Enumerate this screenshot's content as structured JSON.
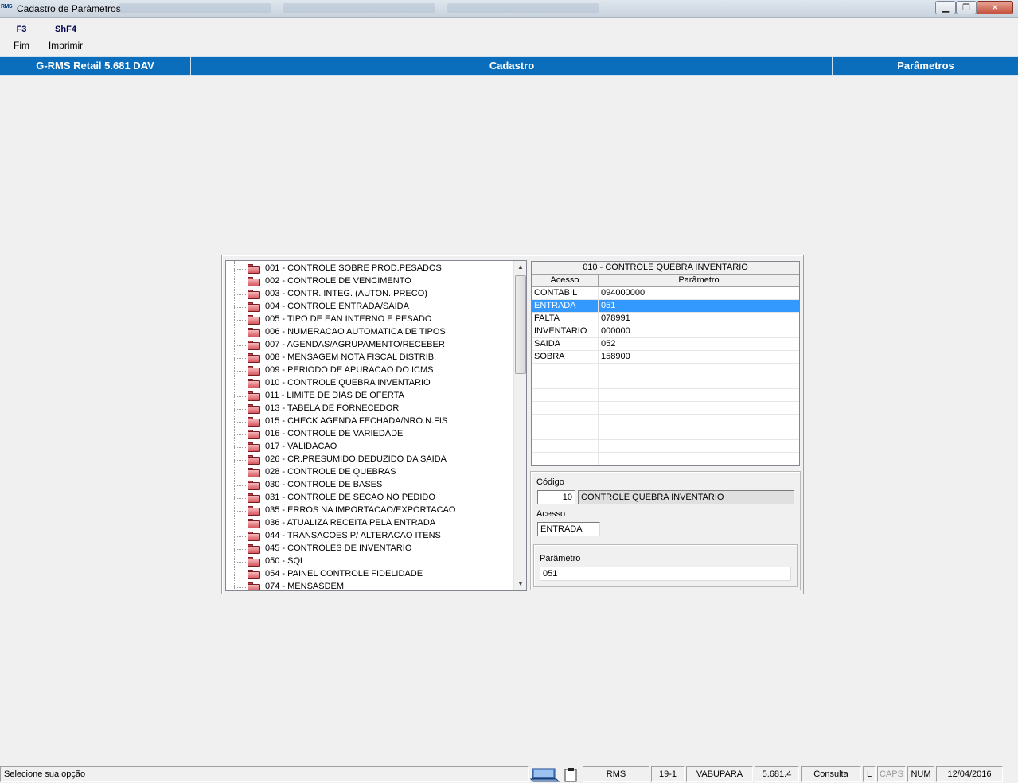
{
  "window": {
    "title": "Cadastro de Parâmetros",
    "app_badge": "RMS"
  },
  "toolbar": {
    "f3_key": "F3",
    "f3_label": "Fim",
    "shf4_key": "ShF4",
    "shf4_label": "Imprimir"
  },
  "header": {
    "product": "G-RMS Retail 5.681 DAV",
    "module": "Cadastro",
    "screen": "Parâmetros"
  },
  "tree": {
    "items": [
      "001 - CONTROLE SOBRE PROD.PESADOS",
      "002 - CONTROLE DE VENCIMENTO",
      "003 - CONTR. INTEG. (AUTON. PRECO)",
      "004 - CONTROLE ENTRADA/SAIDA",
      "005 - TIPO DE EAN INTERNO E PESADO",
      "006 - NUMERACAO AUTOMATICA DE TIPOS",
      "007 - AGENDAS/AGRUPAMENTO/RECEBER",
      "008 - MENSAGEM NOTA FISCAL DISTRIB.",
      "009 - PERIODO DE APURACAO DO ICMS",
      "010 - CONTROLE QUEBRA INVENTARIO",
      "011 - LIMITE DE DIAS DE OFERTA",
      "013 - TABELA DE FORNECEDOR",
      "015 - CHECK AGENDA FECHADA/NRO.N.FIS",
      "016 - CONTROLE DE VARIEDADE",
      "017 - VALIDACAO",
      "026 - CR.PRESUMIDO DEDUZIDO DA SAIDA",
      "028 - CONTROLE DE QUEBRAS",
      "030 - CONTROLE DE BASES",
      "031 - CONTROLE DE SECAO NO PEDIDO",
      "035 - ERROS NA IMPORTACAO/EXPORTACAO",
      "036 - ATUALIZA RECEITA PELA ENTRADA",
      "044 - TRANSACOES P/ ALTERACAO ITENS",
      "045 - CONTROLES DE INVENTARIO",
      "050 - SQL",
      "054 - PAINEL CONTROLE FIDELIDADE",
      "074 - MENSASDEM"
    ]
  },
  "grid": {
    "title": "010 - CONTROLE QUEBRA INVENTARIO",
    "col_acesso": "Acesso",
    "col_parametro": "Parâmetro",
    "rows": [
      {
        "acesso": "CONTABIL",
        "parametro": "094000000"
      },
      {
        "acesso": "ENTRADA",
        "parametro": "051"
      },
      {
        "acesso": "FALTA",
        "parametro": "078991"
      },
      {
        "acesso": "INVENTARIO",
        "parametro": "000000"
      },
      {
        "acesso": "SAIDA",
        "parametro": "052"
      },
      {
        "acesso": "SOBRA",
        "parametro": "158900"
      }
    ],
    "selected_index": 1
  },
  "detail": {
    "codigo_label": "Código",
    "codigo_value": "10",
    "codigo_desc": "CONTROLE QUEBRA INVENTARIO",
    "acesso_label": "Acesso",
    "acesso_value": "ENTRADA",
    "parametro_label": "Parâmetro",
    "parametro_value": "051"
  },
  "status": {
    "message": "Selecione sua opção",
    "system": "RMS",
    "terminal": "19-1",
    "user": "VABUPARA",
    "version": "5.681.4",
    "mode": "Consulta",
    "l": "L",
    "caps": "CAPS",
    "num": "NUM",
    "date": "12/04/2016"
  },
  "colors": {
    "band": "#0a6ebd",
    "selection": "#3399ff",
    "folder": "#d7575e"
  }
}
